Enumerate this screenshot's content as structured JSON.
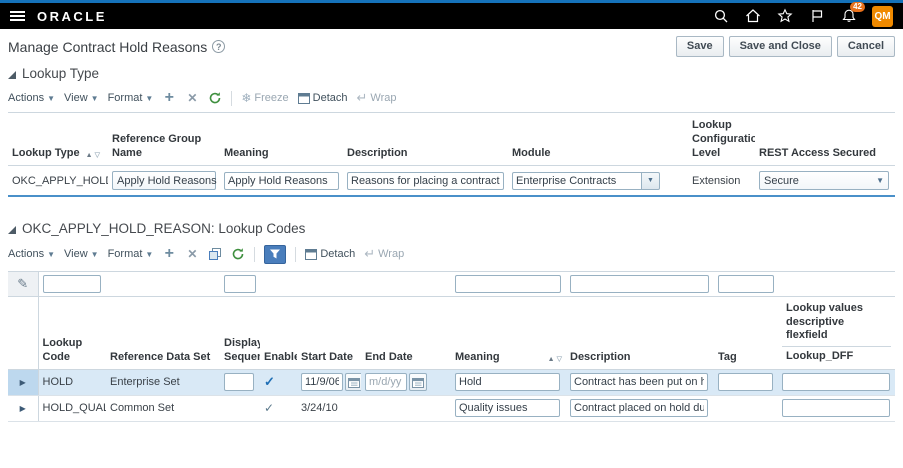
{
  "theme": {
    "accent_blue": "#1572ba",
    "selected_row_bg": "#d9e9f6",
    "current_row_underline": "#4a90c9",
    "avatar_bg": "#f08a00",
    "badge_bg": "#e8711c",
    "qbe_active_bg": "#4a7ebc"
  },
  "app_header": {
    "brand": "ORACLE",
    "notification_count": "42",
    "avatar_initials": "QM",
    "icons": [
      "menu",
      "search",
      "home",
      "favorites",
      "flag",
      "notifications"
    ]
  },
  "page_header": {
    "title": "Manage Contract Hold Reasons",
    "help_symbol": "?",
    "buttons": {
      "save": "Save",
      "save_and_close": "Save and Close",
      "cancel": "Cancel"
    }
  },
  "lookup_type": {
    "section_title": "Lookup Type",
    "toolbar": {
      "actions": "Actions",
      "view": "View",
      "format": "Format",
      "freeze": "Freeze",
      "detach": "Detach",
      "wrap": "Wrap",
      "icons": [
        "add",
        "delete",
        "refresh",
        "freeze",
        "detach",
        "wrap"
      ]
    },
    "columns": [
      "Lookup Type",
      "Reference Group Name",
      "Meaning",
      "Description",
      "Module",
      "Lookup Configuration Level",
      "REST Access Secured"
    ],
    "row": {
      "lookup_type": "OKC_APPLY_HOLD_RE...",
      "reference_group_name": "Apply Hold Reasons",
      "meaning": "Apply Hold Reasons",
      "description": "Reasons for placing a contract on hold.",
      "module": "Enterprise Contracts",
      "lookup_configuration_level": "Extension",
      "rest_access_secured": "Secure"
    }
  },
  "lookup_codes": {
    "section_title": "OKC_APPLY_HOLD_REASON: Lookup Codes",
    "toolbar": {
      "actions": "Actions",
      "view": "View",
      "format": "Format",
      "detach": "Detach",
      "wrap": "Wrap",
      "icons": [
        "add",
        "delete",
        "duplicate",
        "refresh",
        "query-by-example",
        "detach",
        "wrap"
      ]
    },
    "columns": [
      "Lookup Code",
      "Reference Data Set",
      "Display Sequence",
      "Enabled",
      "Start Date",
      "End Date",
      "Meaning",
      "Description",
      "Tag"
    ],
    "dff_column": {
      "group_label": "Lookup values descriptive flexfield",
      "sub_label": "Lookup_DFF"
    },
    "filters": {
      "lookup_code": "",
      "display_sequence": "",
      "meaning": "",
      "description": "",
      "tag": ""
    },
    "rows": [
      {
        "lookup_code": "HOLD",
        "reference_data_set": "Enterprise Set",
        "display_sequence": "",
        "enabled": true,
        "start_date": "11/9/06",
        "end_date": "",
        "end_date_placeholder": "m/d/yy",
        "meaning": "Hold",
        "description": "Contract has been put on hold to suspend ex",
        "tag": "",
        "lookup_dff": "",
        "selected": true
      },
      {
        "lookup_code": "HOLD_QUALITY",
        "reference_data_set": "Common Set",
        "display_sequence": "",
        "enabled": true,
        "start_date": "3/24/10",
        "end_date": "",
        "meaning": "Quality issues",
        "description": "Contract placed on hold due to quality issues",
        "tag": "",
        "lookup_dff": "",
        "selected": false
      }
    ]
  }
}
